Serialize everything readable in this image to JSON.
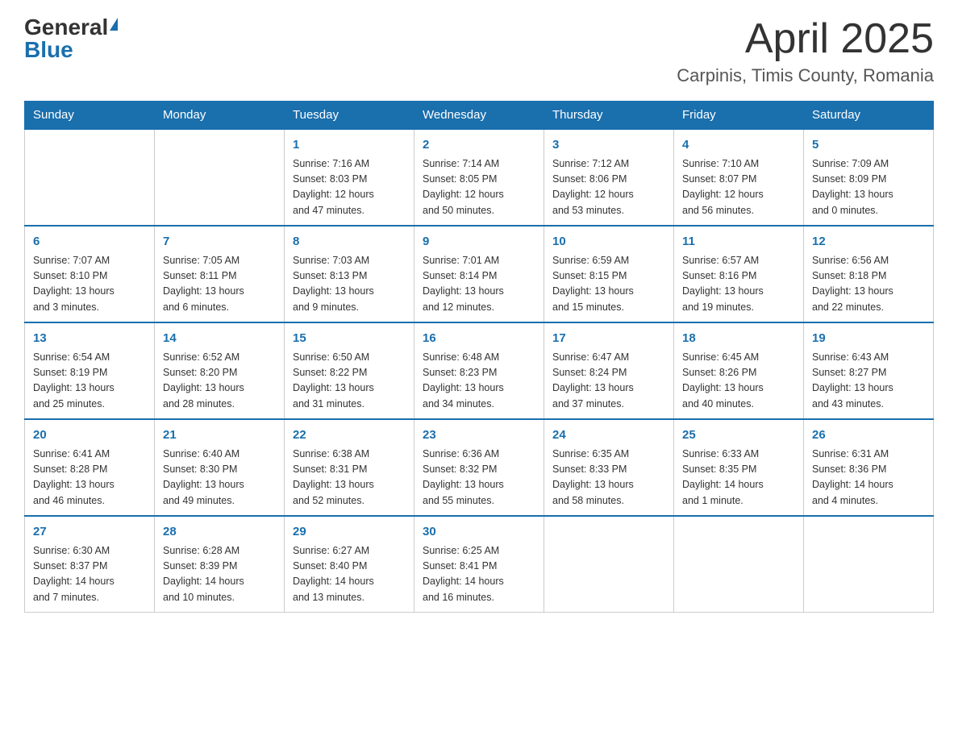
{
  "header": {
    "logo_general": "General",
    "logo_blue": "Blue",
    "title": "April 2025",
    "subtitle": "Carpinis, Timis County, Romania"
  },
  "days_of_week": [
    "Sunday",
    "Monday",
    "Tuesday",
    "Wednesday",
    "Thursday",
    "Friday",
    "Saturday"
  ],
  "weeks": [
    [
      {
        "day": "",
        "info": ""
      },
      {
        "day": "",
        "info": ""
      },
      {
        "day": "1",
        "info": "Sunrise: 7:16 AM\nSunset: 8:03 PM\nDaylight: 12 hours\nand 47 minutes."
      },
      {
        "day": "2",
        "info": "Sunrise: 7:14 AM\nSunset: 8:05 PM\nDaylight: 12 hours\nand 50 minutes."
      },
      {
        "day": "3",
        "info": "Sunrise: 7:12 AM\nSunset: 8:06 PM\nDaylight: 12 hours\nand 53 minutes."
      },
      {
        "day": "4",
        "info": "Sunrise: 7:10 AM\nSunset: 8:07 PM\nDaylight: 12 hours\nand 56 minutes."
      },
      {
        "day": "5",
        "info": "Sunrise: 7:09 AM\nSunset: 8:09 PM\nDaylight: 13 hours\nand 0 minutes."
      }
    ],
    [
      {
        "day": "6",
        "info": "Sunrise: 7:07 AM\nSunset: 8:10 PM\nDaylight: 13 hours\nand 3 minutes."
      },
      {
        "day": "7",
        "info": "Sunrise: 7:05 AM\nSunset: 8:11 PM\nDaylight: 13 hours\nand 6 minutes."
      },
      {
        "day": "8",
        "info": "Sunrise: 7:03 AM\nSunset: 8:13 PM\nDaylight: 13 hours\nand 9 minutes."
      },
      {
        "day": "9",
        "info": "Sunrise: 7:01 AM\nSunset: 8:14 PM\nDaylight: 13 hours\nand 12 minutes."
      },
      {
        "day": "10",
        "info": "Sunrise: 6:59 AM\nSunset: 8:15 PM\nDaylight: 13 hours\nand 15 minutes."
      },
      {
        "day": "11",
        "info": "Sunrise: 6:57 AM\nSunset: 8:16 PM\nDaylight: 13 hours\nand 19 minutes."
      },
      {
        "day": "12",
        "info": "Sunrise: 6:56 AM\nSunset: 8:18 PM\nDaylight: 13 hours\nand 22 minutes."
      }
    ],
    [
      {
        "day": "13",
        "info": "Sunrise: 6:54 AM\nSunset: 8:19 PM\nDaylight: 13 hours\nand 25 minutes."
      },
      {
        "day": "14",
        "info": "Sunrise: 6:52 AM\nSunset: 8:20 PM\nDaylight: 13 hours\nand 28 minutes."
      },
      {
        "day": "15",
        "info": "Sunrise: 6:50 AM\nSunset: 8:22 PM\nDaylight: 13 hours\nand 31 minutes."
      },
      {
        "day": "16",
        "info": "Sunrise: 6:48 AM\nSunset: 8:23 PM\nDaylight: 13 hours\nand 34 minutes."
      },
      {
        "day": "17",
        "info": "Sunrise: 6:47 AM\nSunset: 8:24 PM\nDaylight: 13 hours\nand 37 minutes."
      },
      {
        "day": "18",
        "info": "Sunrise: 6:45 AM\nSunset: 8:26 PM\nDaylight: 13 hours\nand 40 minutes."
      },
      {
        "day": "19",
        "info": "Sunrise: 6:43 AM\nSunset: 8:27 PM\nDaylight: 13 hours\nand 43 minutes."
      }
    ],
    [
      {
        "day": "20",
        "info": "Sunrise: 6:41 AM\nSunset: 8:28 PM\nDaylight: 13 hours\nand 46 minutes."
      },
      {
        "day": "21",
        "info": "Sunrise: 6:40 AM\nSunset: 8:30 PM\nDaylight: 13 hours\nand 49 minutes."
      },
      {
        "day": "22",
        "info": "Sunrise: 6:38 AM\nSunset: 8:31 PM\nDaylight: 13 hours\nand 52 minutes."
      },
      {
        "day": "23",
        "info": "Sunrise: 6:36 AM\nSunset: 8:32 PM\nDaylight: 13 hours\nand 55 minutes."
      },
      {
        "day": "24",
        "info": "Sunrise: 6:35 AM\nSunset: 8:33 PM\nDaylight: 13 hours\nand 58 minutes."
      },
      {
        "day": "25",
        "info": "Sunrise: 6:33 AM\nSunset: 8:35 PM\nDaylight: 14 hours\nand 1 minute."
      },
      {
        "day": "26",
        "info": "Sunrise: 6:31 AM\nSunset: 8:36 PM\nDaylight: 14 hours\nand 4 minutes."
      }
    ],
    [
      {
        "day": "27",
        "info": "Sunrise: 6:30 AM\nSunset: 8:37 PM\nDaylight: 14 hours\nand 7 minutes."
      },
      {
        "day": "28",
        "info": "Sunrise: 6:28 AM\nSunset: 8:39 PM\nDaylight: 14 hours\nand 10 minutes."
      },
      {
        "day": "29",
        "info": "Sunrise: 6:27 AM\nSunset: 8:40 PM\nDaylight: 14 hours\nand 13 minutes."
      },
      {
        "day": "30",
        "info": "Sunrise: 6:25 AM\nSunset: 8:41 PM\nDaylight: 14 hours\nand 16 minutes."
      },
      {
        "day": "",
        "info": ""
      },
      {
        "day": "",
        "info": ""
      },
      {
        "day": "",
        "info": ""
      }
    ]
  ]
}
